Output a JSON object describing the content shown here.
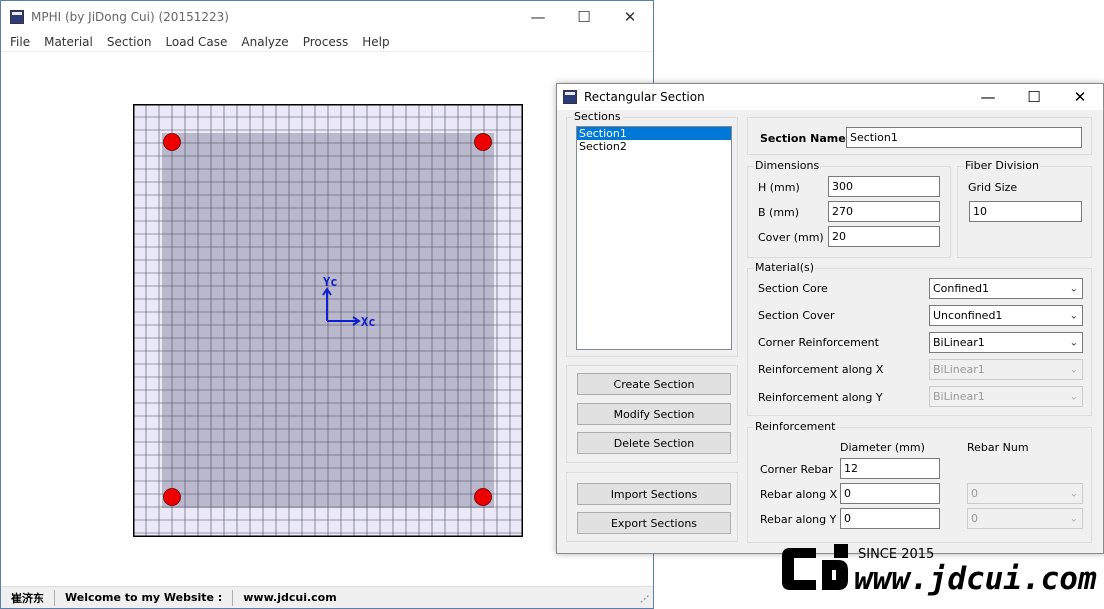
{
  "main_window": {
    "title": "MPHI (by JiDong Cui) (20151223)",
    "menu": [
      "File",
      "Material",
      "Section",
      "Load Case",
      "Analyze",
      "Process",
      "Help"
    ],
    "canvas": {
      "grid_divisions": 10,
      "colors": {
        "grid_bg": "#ebe9f7",
        "core_fill": "#b9b8cc",
        "grid_line": "#4a4a60",
        "rebar": "#ee0000",
        "axis": "#1020d0"
      },
      "axis_x_label": "Xc",
      "axis_y_label": "Yc"
    },
    "status": [
      "崔济东",
      "Welcome to my Website :",
      "www.jdcui.com"
    ]
  },
  "dialog": {
    "title": "Rectangular Section",
    "sections_group": "Sections",
    "sections": [
      "Section1",
      "Section2"
    ],
    "selected_section": "Section1",
    "buttons": {
      "create": "Create Section",
      "modify": "Modify Section",
      "delete": "Delete Section",
      "import": "Import Sections",
      "export": "Export Sections"
    },
    "section_name_label": "Section Name",
    "section_name_value": "Section1",
    "dimensions": {
      "group": "Dimensions",
      "h_label": "H (mm)",
      "h_value": "300",
      "b_label": "B (mm)",
      "b_value": "270",
      "cover_label": "Cover (mm)",
      "cover_value": "20"
    },
    "fiber": {
      "group": "Fiber Division",
      "grid_label": "Grid Size",
      "grid_value": "10"
    },
    "materials": {
      "group": "Material(s)",
      "core_label": "Section Core",
      "core_value": "Confined1",
      "cover_label": "Section Cover",
      "cover_value": "Unconfined1",
      "corner_label": "Corner Reinforcement",
      "corner_value": "BiLinear1",
      "alongx_label": "Reinforcement along X",
      "alongx_value": "BiLinear1",
      "alongy_label": "Reinforcement along Y",
      "alongy_value": "BiLinear1"
    },
    "reinforcement": {
      "group": "Reinforcement",
      "diameter_header": "Diameter (mm)",
      "num_header": "Rebar Num",
      "corner_label": "Corner Rebar",
      "corner_diameter": "12",
      "x_label": "Rebar along X",
      "x_diameter": "0",
      "x_num": "0",
      "y_label": "Rebar along Y",
      "y_diameter": "0",
      "y_num": "0"
    }
  },
  "watermark": {
    "since": "SINCE 2015",
    "url": "www.jdcui.com"
  }
}
